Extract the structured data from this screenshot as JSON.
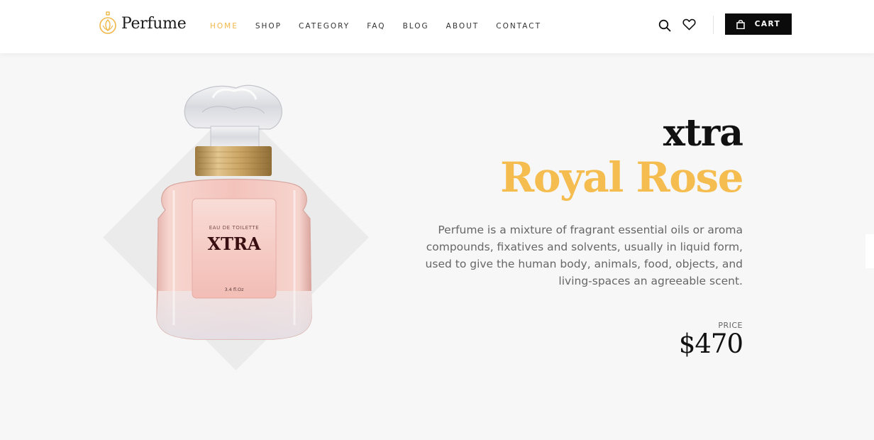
{
  "brand": {
    "name": "Perfume",
    "logo_icon": "perfume-bottle-logo-icon"
  },
  "nav": {
    "items": [
      {
        "label": "HOME",
        "active": true
      },
      {
        "label": "SHOP",
        "active": false
      },
      {
        "label": "CATEGORY",
        "active": false
      },
      {
        "label": "FAQ",
        "active": false
      },
      {
        "label": "BLOG",
        "active": false
      },
      {
        "label": "ABOUT",
        "active": false
      },
      {
        "label": "CONTACT",
        "active": false
      }
    ]
  },
  "header_actions": {
    "search_icon": "search-icon",
    "wishlist_icon": "heart-icon",
    "cart_label": "CART",
    "cart_icon": "shopping-bag-icon"
  },
  "hero": {
    "title_line1": "xtra",
    "title_line2": "Royal Rose",
    "description": "Perfume is a mixture of fragrant essential oils or aroma compounds, fixatives and solvents, usually in liquid form, used to give the human body, animals, food, objects, and living-spaces an agreeable scent.",
    "price_label": "PRICE",
    "price": "$470",
    "bottle_label": {
      "type": "EAU DE TOILETTE",
      "name": "XTRA",
      "volume": "3.4 fl.Oz"
    }
  },
  "colors": {
    "accent": "#f5bd4f",
    "nav_active": "#f0b84a",
    "cart_bg": "#0b0b0b",
    "page_bg": "#f7f7f7",
    "diamond": "#ebebeb"
  }
}
